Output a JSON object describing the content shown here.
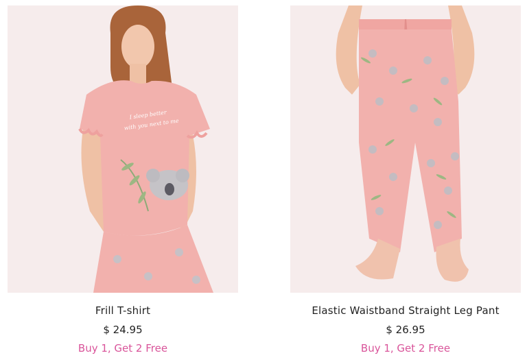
{
  "products": [
    {
      "name": "Frill T-shirt",
      "price": "$ 24.95",
      "promo": "Buy 1, Get 2 Free",
      "shirt_print": "I sleep better with you next to me"
    },
    {
      "name": "Elastic Waistband Straight Leg Pant",
      "price": "$ 26.95",
      "promo": "Buy 1, Get 2 Free"
    }
  ],
  "colors": {
    "image_bg": "#f7eded",
    "garment_pink": "#f2b1ad",
    "promo_pink": "#d9549a",
    "text": "#222222"
  }
}
